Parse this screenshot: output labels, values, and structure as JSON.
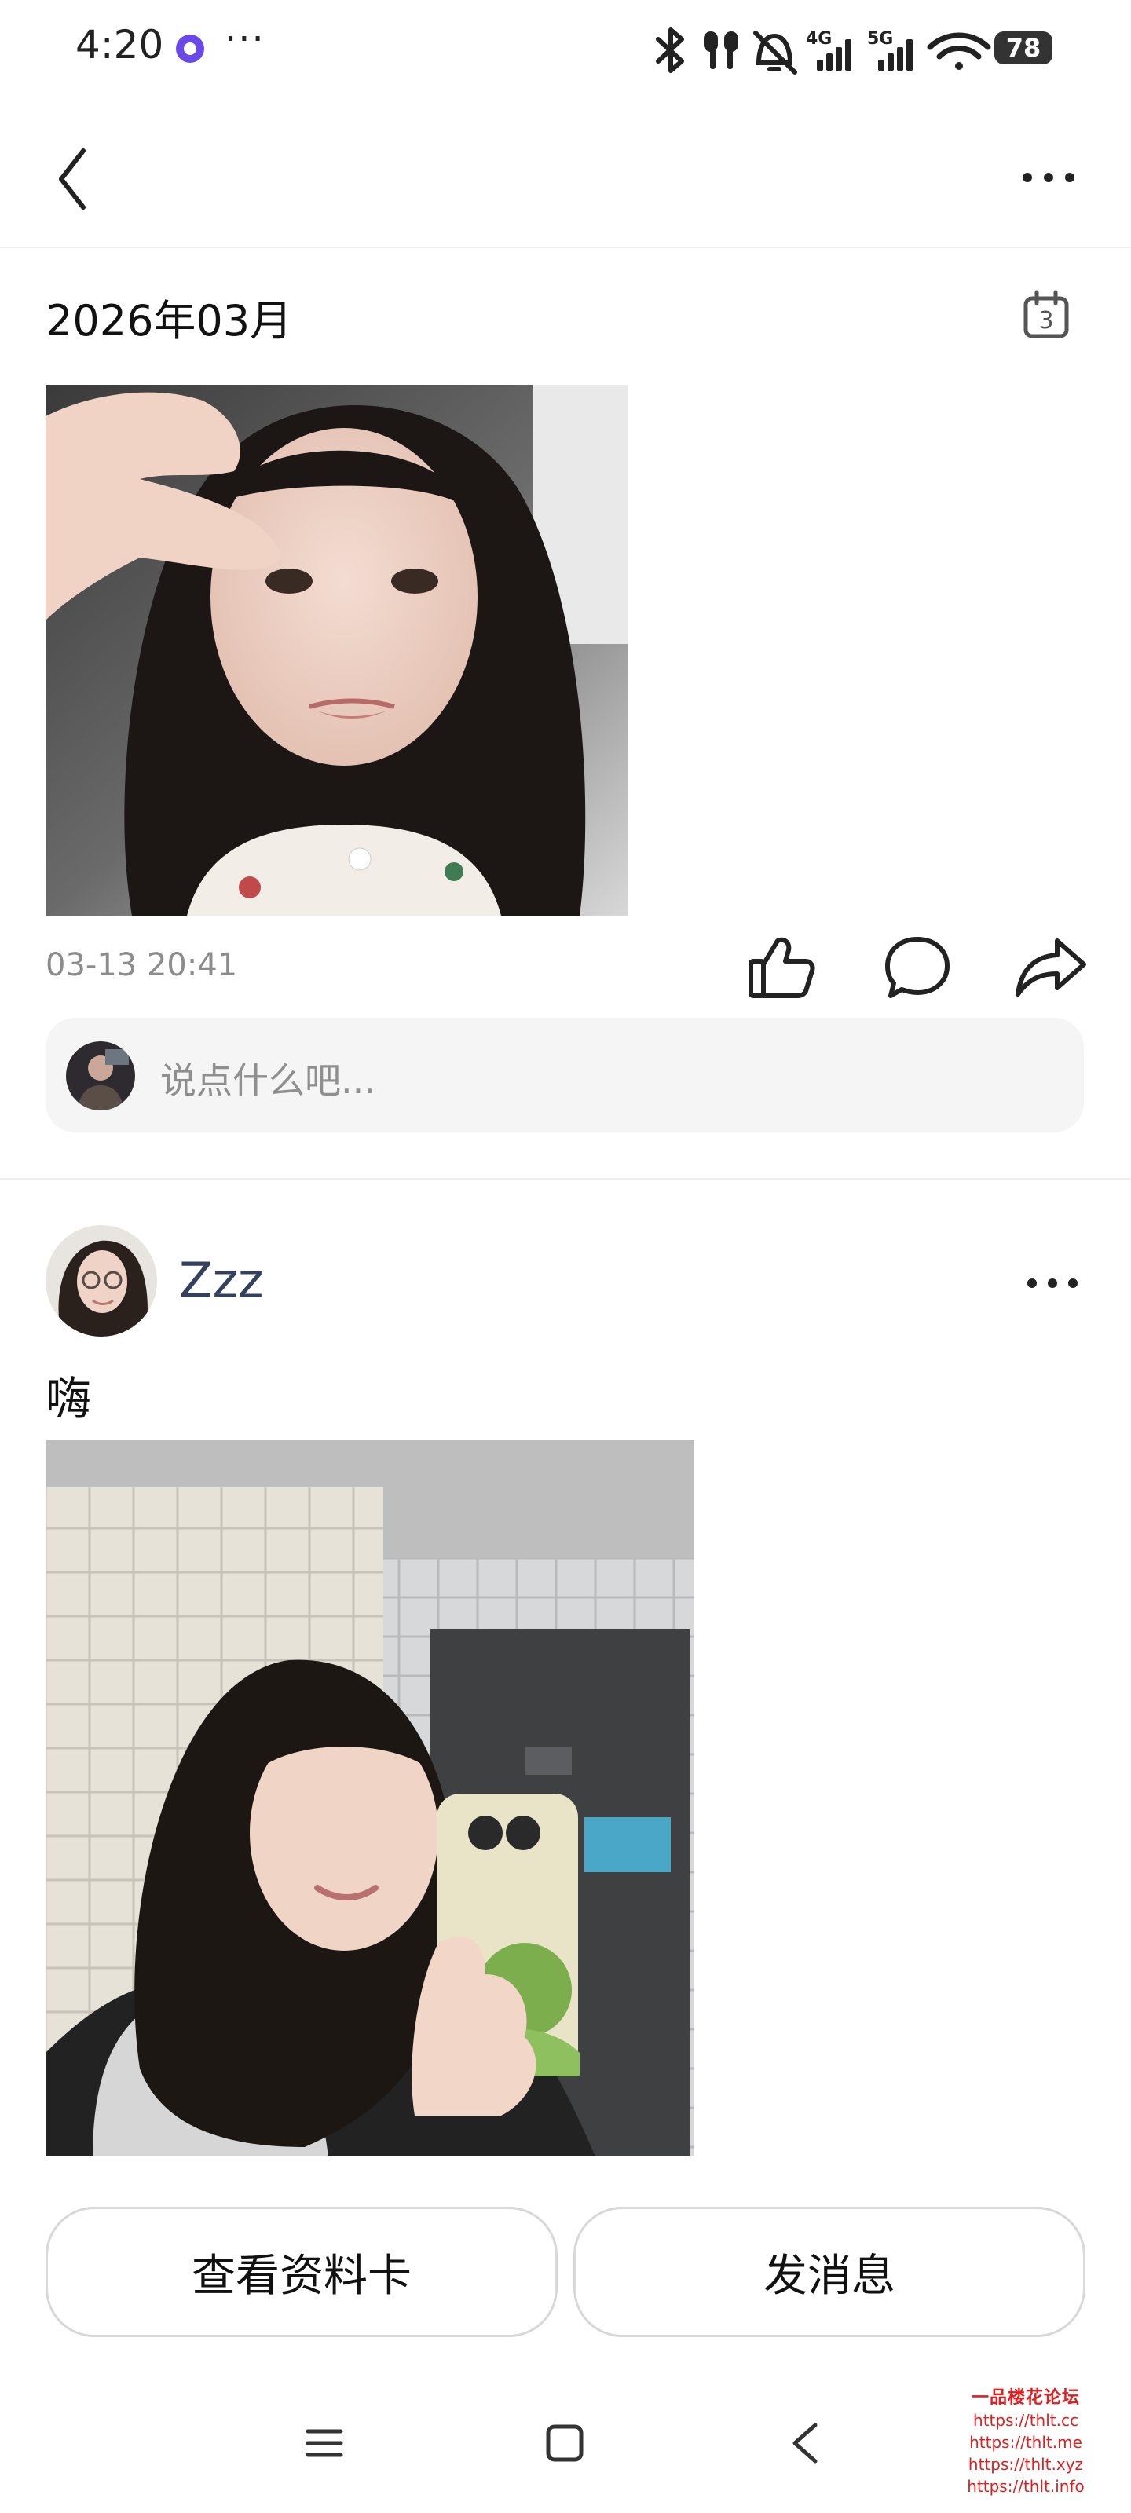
{
  "status_bar": {
    "time": "4:20",
    "more": "···",
    "battery": "78",
    "icons": [
      "bluetooth-icon",
      "earbuds-icon",
      "silent-icon",
      "signal-4g-icon",
      "signal-5g-icon",
      "wifi-icon",
      "battery-icon"
    ],
    "network_labels": [
      "4G",
      "5G"
    ]
  },
  "header": {
    "back_icon": "chevron-left-icon",
    "more_icon": "more-horizontal-icon"
  },
  "section": {
    "month": "2026年03月",
    "calendar_day": "3"
  },
  "post1": {
    "time": "03-13 20:41",
    "comment_placeholder": "说点什么吧..."
  },
  "post2": {
    "username": "Zzz",
    "text": "嗨"
  },
  "actions": {
    "profile_card": "查看资料卡",
    "send_message": "发消息"
  },
  "watermark": {
    "title": "一品楼花论坛",
    "links": [
      "https://thlt.cc",
      "https://thlt.me",
      "https://thlt.xyz",
      "https://thlt.info"
    ]
  },
  "colors": {
    "username": "#33415f",
    "placeholder": "#8f8f8f",
    "timestamp": "#8c8c8c",
    "accent_app_icon": "#6a49e8",
    "watermark": "#e02020"
  }
}
